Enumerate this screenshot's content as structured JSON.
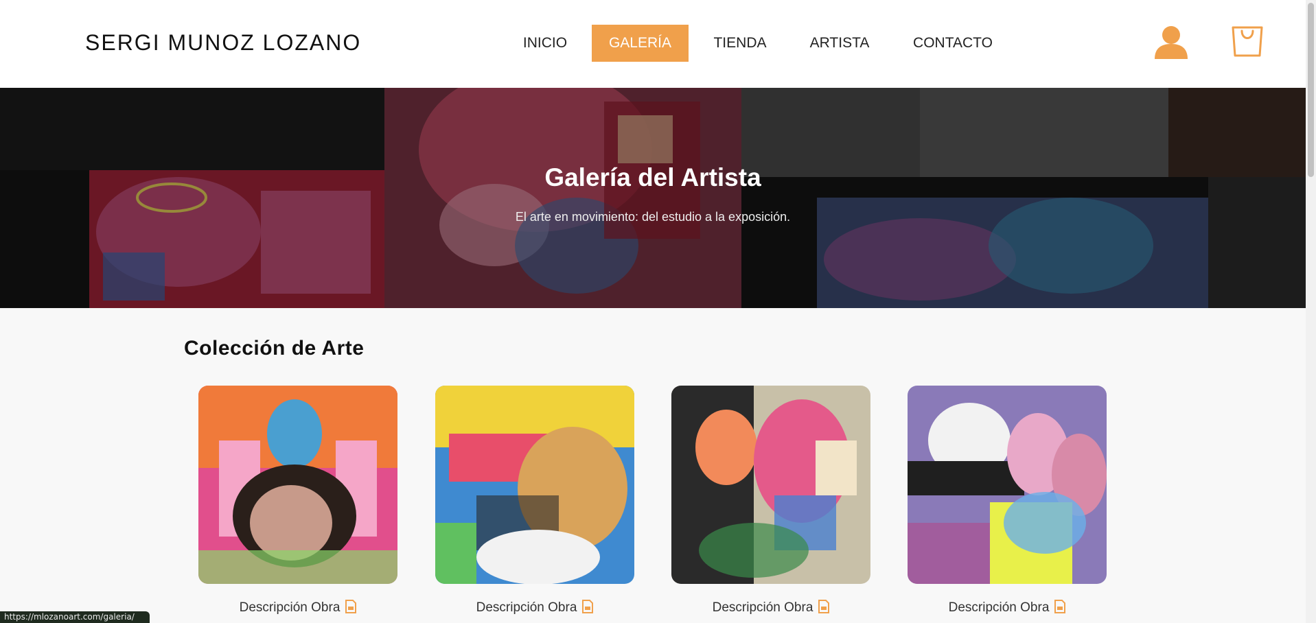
{
  "brand": "SERGI MUNOZ LOZANO",
  "nav": [
    {
      "label": "INICIO",
      "active": false
    },
    {
      "label": "GALERÍA",
      "active": true
    },
    {
      "label": "TIENDA",
      "active": false
    },
    {
      "label": "ARTISTA",
      "active": false
    },
    {
      "label": "CONTACTO",
      "active": false
    }
  ],
  "icons": {
    "user": "user-icon",
    "cart": "shopping-bag-icon",
    "doc": "document-icon"
  },
  "hero": {
    "title": "Galería del Artista",
    "subtitle": "El arte en movimiento: del estudio a la exposición."
  },
  "collection": {
    "title": "Colección de Arte",
    "items": [
      {
        "caption": "Descripción Obra"
      },
      {
        "caption": "Descripción Obra"
      },
      {
        "caption": "Descripción Obra"
      },
      {
        "caption": "Descripción Obra"
      }
    ]
  },
  "status_url": "https://mlozanoart.com/galeria/",
  "colors": {
    "accent": "#f0a04b",
    "text": "#222222",
    "background": "#f8f8f8"
  }
}
